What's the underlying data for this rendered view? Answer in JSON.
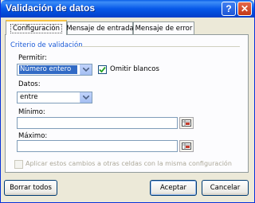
{
  "window": {
    "title": "Validación de datos",
    "help_glyph": "?",
    "close_glyph": "✕"
  },
  "tabs": [
    {
      "label": "Configuración",
      "active": true
    },
    {
      "label": "Mensaje de entrada",
      "active": false
    },
    {
      "label": "Mensaje de error",
      "active": false
    }
  ],
  "criteria": {
    "group_label": "Criterio de validación",
    "permitir_label": "Permitir:",
    "permitir_value": "Número entero",
    "omitir_label": "Omitir blancos",
    "omitir_checked": true,
    "datos_label": "Datos:",
    "datos_value": "entre",
    "minimo_label": "Mínimo:",
    "minimo_value": "",
    "maximo_label": "Máximo:",
    "maximo_value": ""
  },
  "apply_all": {
    "label": "Aplicar estos cambios a otras celdas con la misma configuración",
    "checked": false,
    "enabled": false
  },
  "buttons": {
    "clear_all": "Borrar todos",
    "accept": "Aceptar",
    "cancel": "Cancelar"
  },
  "colors": {
    "title_bar": "#0758e8",
    "group_label": "#1c5bd7",
    "selection": "#316ac5",
    "dialog_bg": "#ece9d8"
  }
}
